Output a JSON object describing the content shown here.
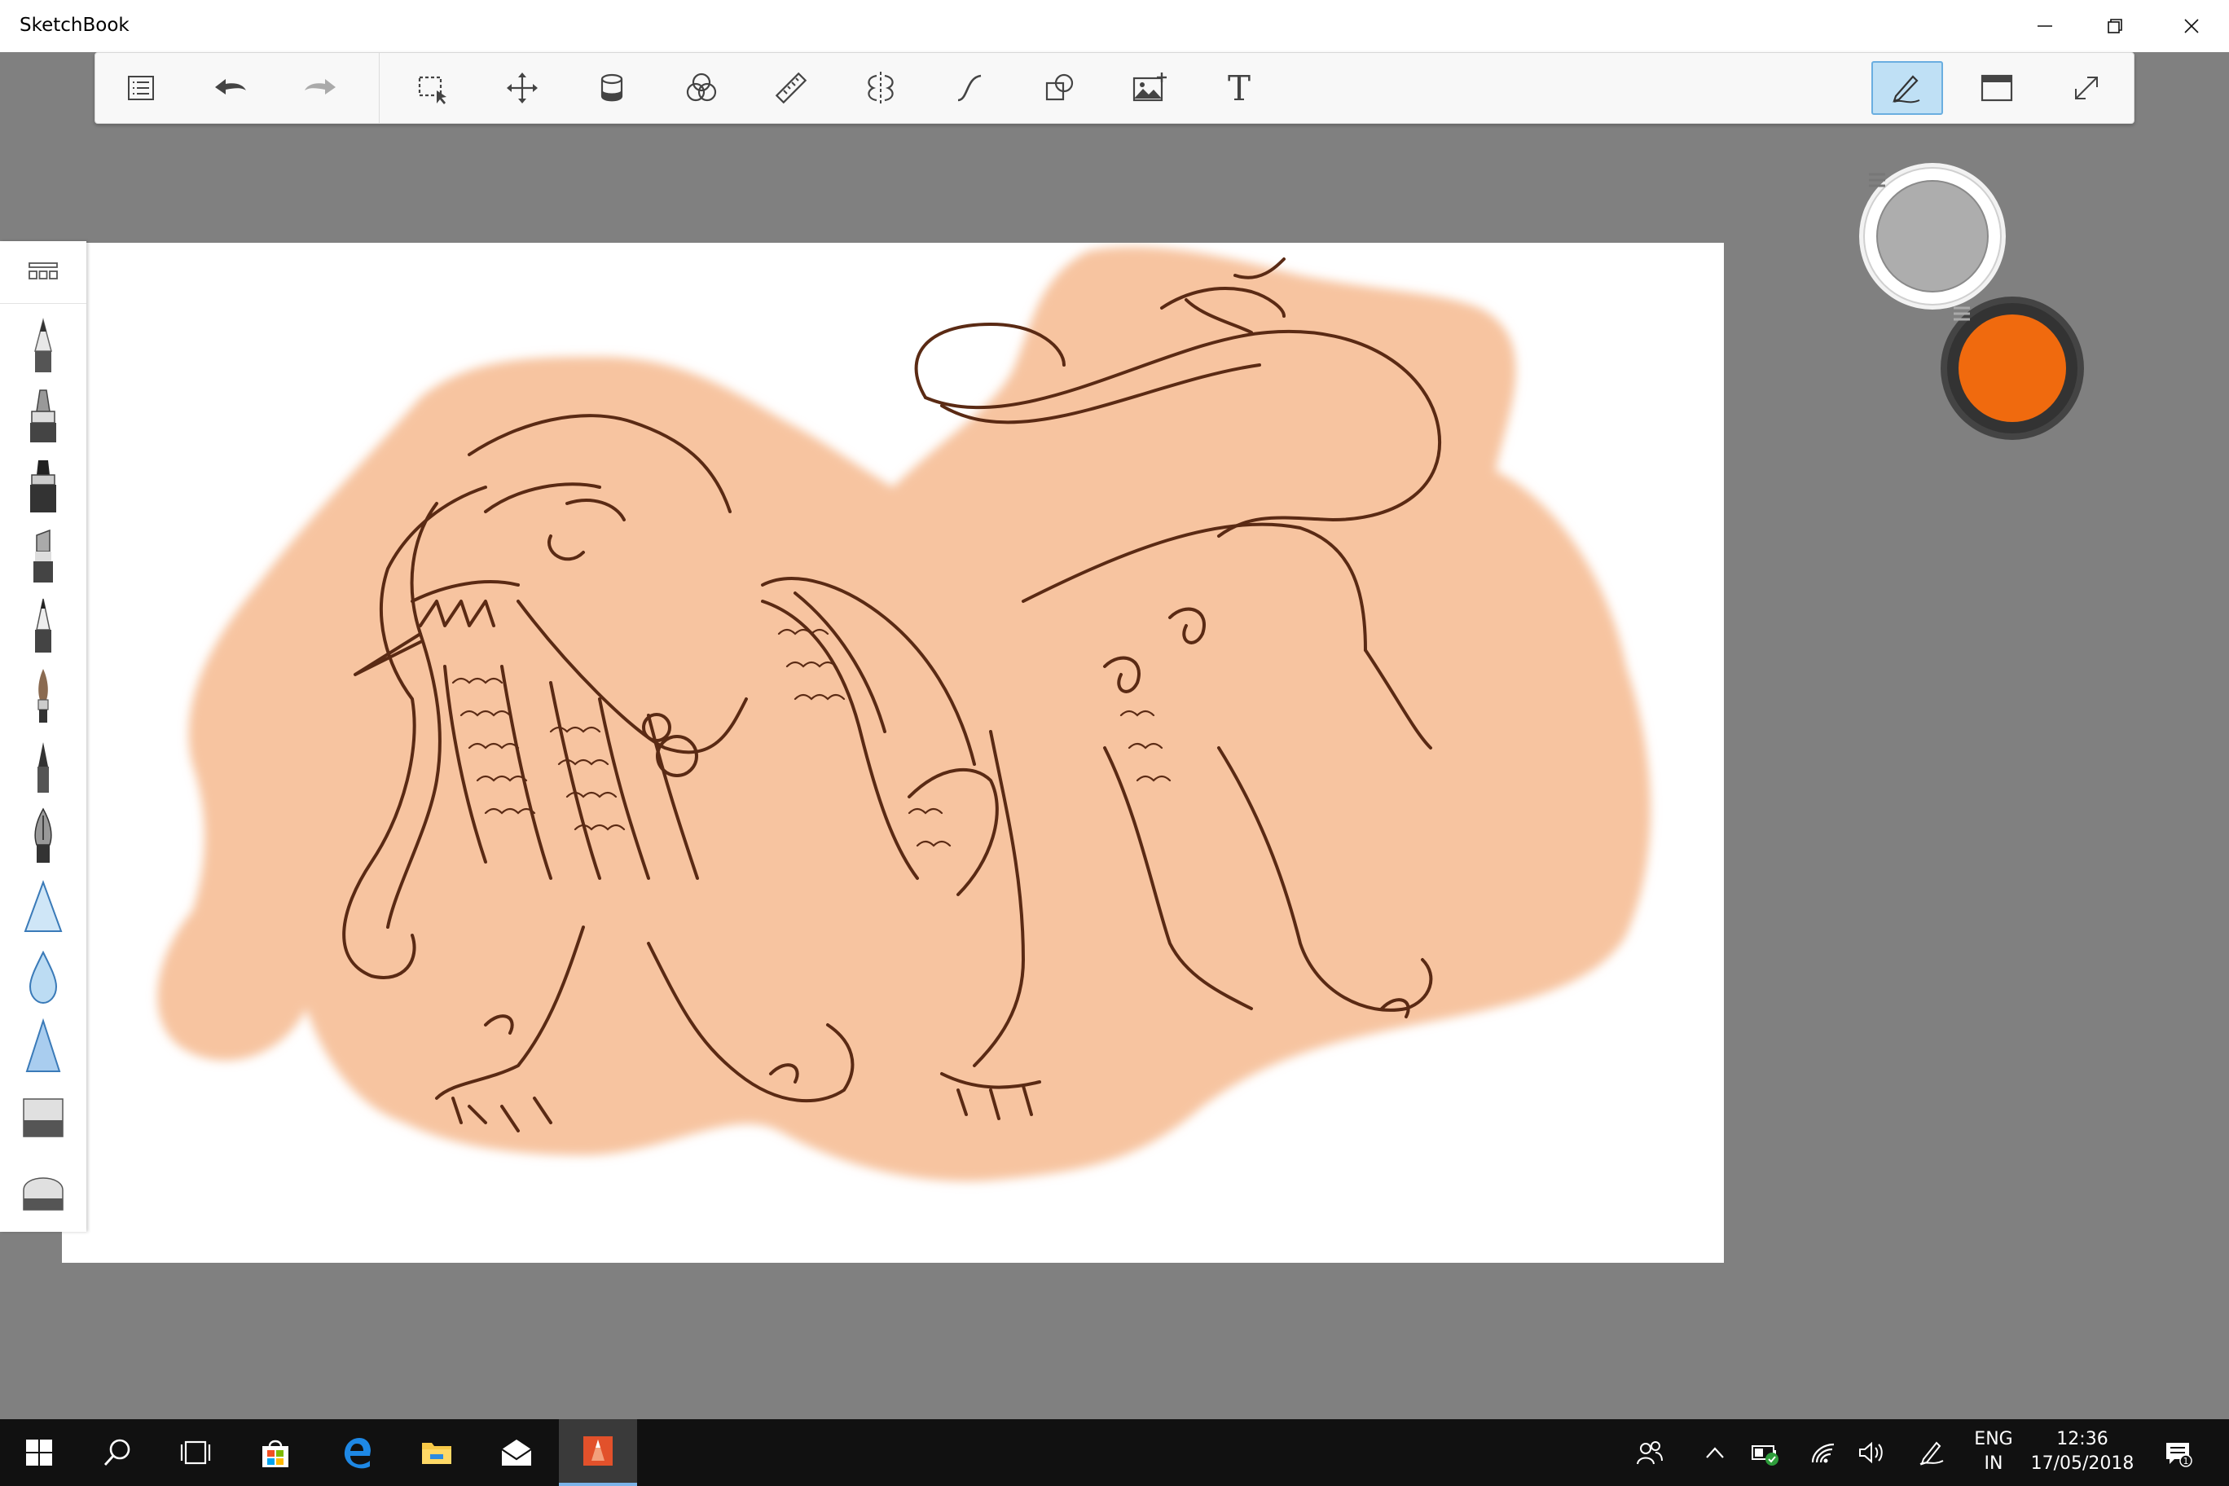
{
  "window": {
    "title": "SketchBook",
    "controls": [
      "minimize-icon",
      "restore-icon",
      "close-icon"
    ]
  },
  "toolbar": {
    "left_group": [
      "lagoon-icon",
      "undo-icon",
      "redo-icon"
    ],
    "tools": [
      "select-icon",
      "transform-icon",
      "fill-icon",
      "color-editor-icon",
      "ruler-icon",
      "symmetry-icon",
      "curve-icon",
      "shapes-icon",
      "import-image-icon",
      "text-icon"
    ],
    "text_label": "T",
    "right_group": [
      "brush-mode-icon",
      "window-layout-icon",
      "fullscreen-icon"
    ],
    "active_tool": "brush-mode"
  },
  "brush_palette": {
    "brushes": [
      "pencil",
      "airbrush",
      "marker",
      "chisel-marker",
      "ballpoint-pen",
      "paintbrush",
      "ink-pen",
      "fountain-pen",
      "smudge",
      "blur",
      "sharpen",
      "hard-eraser",
      "soft-eraser"
    ]
  },
  "color_puck": {
    "inner_color": "#adadad",
    "outer_color": "#f06a0e"
  },
  "colors": {
    "background": "#808080",
    "canvas": "#ffffff",
    "skin": "#f7c4a0",
    "ink": "#5a2a14",
    "accent": "#f06a0e"
  },
  "taskbar": {
    "apps": [
      "windows-start-icon",
      "search-icon",
      "task-view-icon",
      "store-icon",
      "edge-icon",
      "file-explorer-icon",
      "mail-icon",
      "sketchbook-app-icon"
    ],
    "language_line1": "ENG",
    "language_line2": "IN",
    "time": "12:36",
    "date": "17/05/2018",
    "notification_count": "1"
  }
}
